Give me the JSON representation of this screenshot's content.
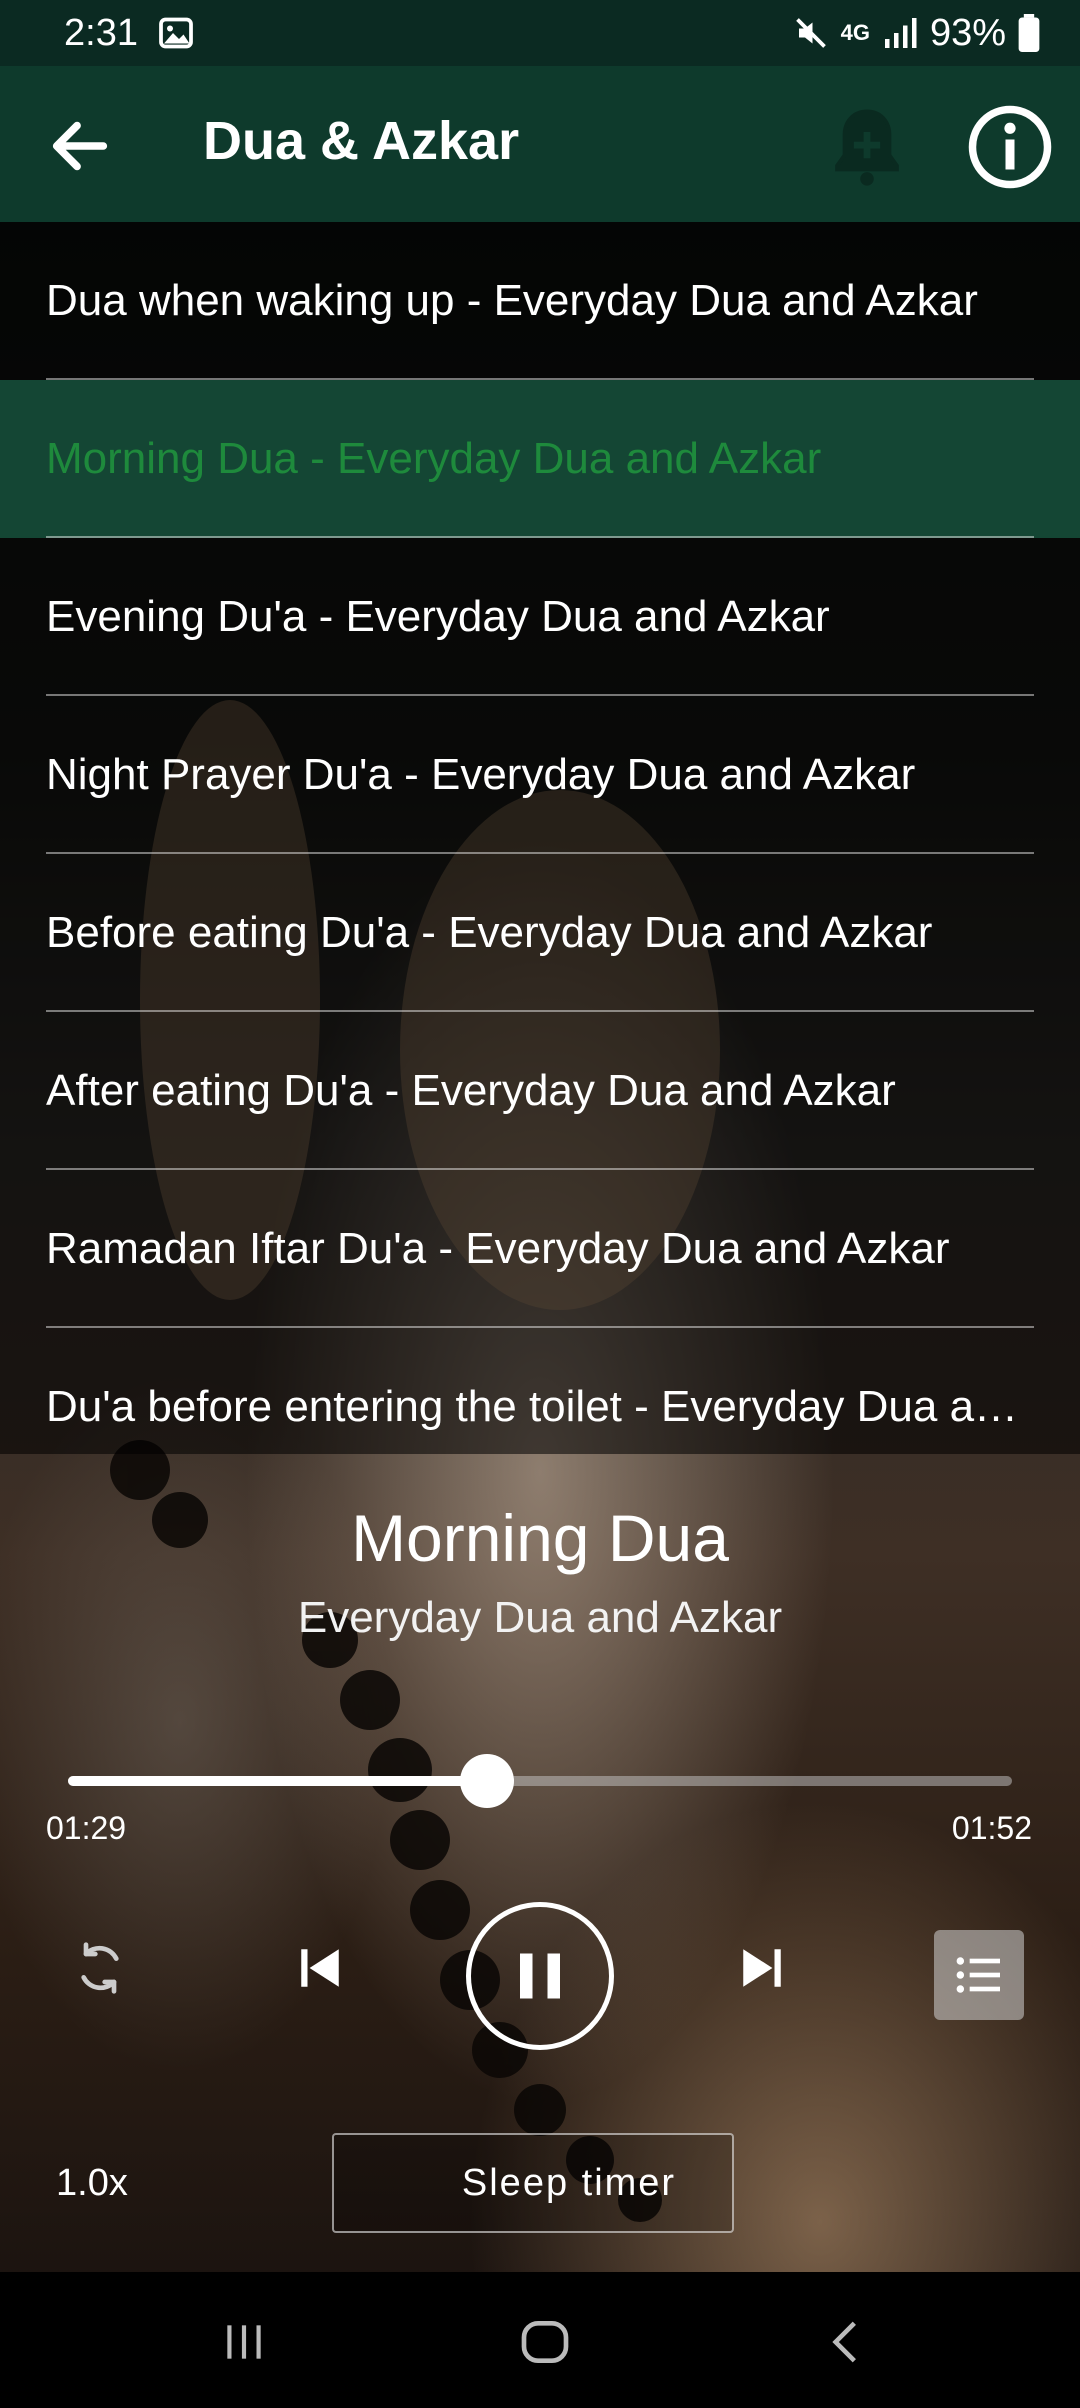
{
  "status_bar": {
    "time": "2:31",
    "network": "4G",
    "battery": "93%",
    "icons": [
      "gallery-icon",
      "mute-icon",
      "signal-icon",
      "battery-icon"
    ]
  },
  "app_bar": {
    "title": "Dua & Azkar",
    "icons": [
      "back-arrow-icon",
      "bell-plus-icon",
      "info-icon"
    ]
  },
  "playlist": {
    "items": [
      {
        "label": "Dua when waking up - Everyday Dua and Azkar",
        "active": false
      },
      {
        "label": "Morning Dua - Everyday Dua and Azkar",
        "active": true
      },
      {
        "label": "Evening Du'a - Everyday Dua and Azkar",
        "active": false
      },
      {
        "label": "Night Prayer Du'a - Everyday Dua and Azkar",
        "active": false
      },
      {
        "label": "Before eating Du'a - Everyday Dua and Azkar",
        "active": false
      },
      {
        "label": "After eating Du'a - Everyday Dua and Azkar",
        "active": false
      },
      {
        "label": "Ramadan Iftar Du'a - Everyday Dua and Azkar",
        "active": false
      },
      {
        "label": "Du'a before entering the toilet - Everyday Dua and Azkar",
        "active": false
      }
    ]
  },
  "now_playing": {
    "title": "Morning Dua",
    "subtitle": "Everyday Dua and Azkar",
    "elapsed": "01:29",
    "duration": "01:52",
    "progress_fraction": 0.444
  },
  "controls": {
    "icons": [
      "repeat-icon",
      "previous-icon",
      "pause-icon",
      "next-icon",
      "playlist-icon"
    ],
    "speed": "1.0x",
    "sleep_timer_label": "Sleep timer"
  },
  "colors": {
    "app_bar": "#0e3a2c",
    "status_bar": "#0b2a22",
    "active_row_bg": "#164e3a",
    "active_row_text": "#1e8a3c"
  }
}
